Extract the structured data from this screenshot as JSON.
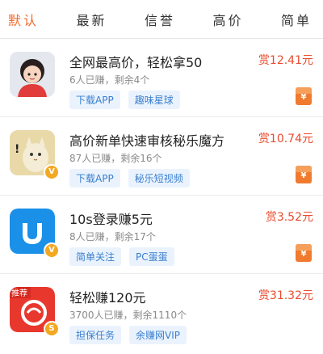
{
  "tabs": [
    "默认",
    "最新",
    "信誉",
    "高价",
    "简单"
  ],
  "active_tab_index": 0,
  "accent_color": "#f26b2d",
  "reward_color": "#e94b2e",
  "tag_color": "#3a7fd0",
  "tasks": [
    {
      "title": "全网最高价，轻松拿50",
      "meta": "6人已赚，剩余4个",
      "tags": [
        "下载APP",
        "趣味星球"
      ],
      "reward": "赏12.41元",
      "avatar": "girl-avatar",
      "verified": false
    },
    {
      "title": "高价新单快速审核秘乐魔方",
      "meta": "87人已赚，剩余16个",
      "tags": [
        "下载APP",
        "秘乐短视频"
      ],
      "reward": "赏10.74元",
      "avatar": "cat-avatar",
      "verified": true,
      "verified_mark": "V"
    },
    {
      "title": "10s登录赚5元",
      "meta": "8人已赚，剩余17个",
      "tags": [
        "简单关注",
        "PC蛋蛋"
      ],
      "reward": "赏3.52元",
      "avatar": "app-logo",
      "verified": true,
      "verified_mark": "V"
    },
    {
      "title": "轻松赚120元",
      "meta": "3700人已赚，剩余1110个",
      "tags": [
        "担保任务",
        "余赚网VIP"
      ],
      "reward": "赏31.32元",
      "avatar": "red-app-logo",
      "avatar_label": "推荐",
      "verified": true,
      "verified_mark": "S"
    }
  ],
  "packet_mark": "¥"
}
